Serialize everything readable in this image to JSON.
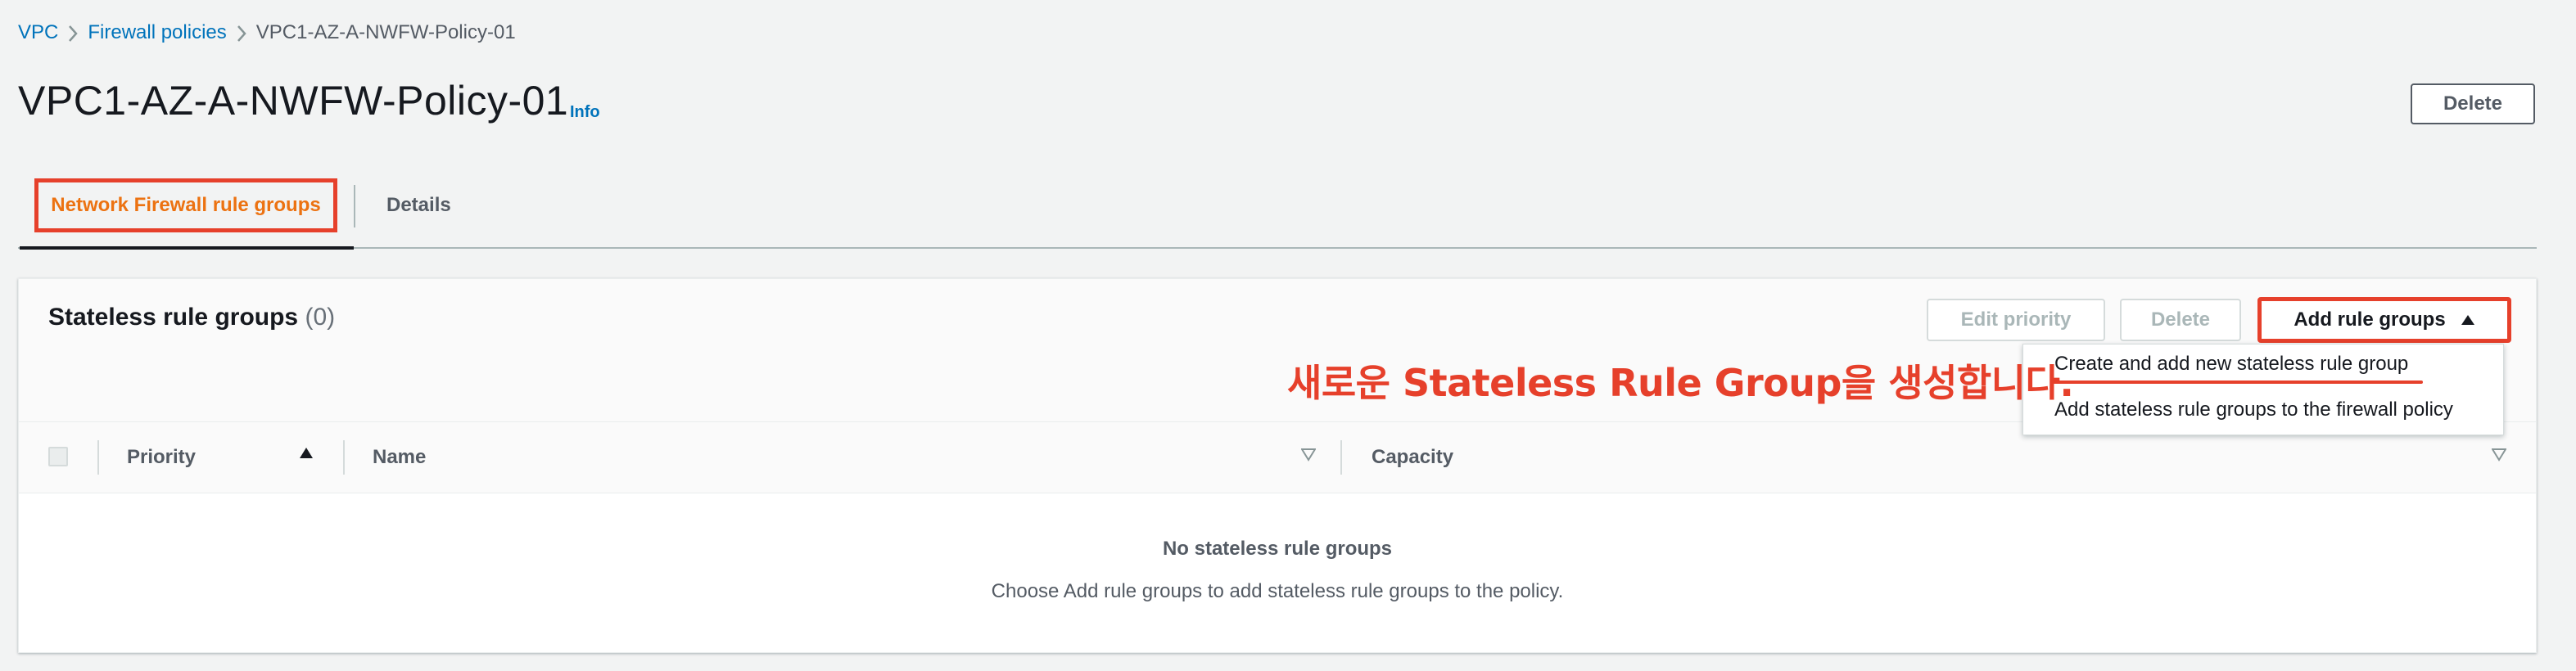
{
  "breadcrumb": {
    "items": [
      "VPC",
      "Firewall policies"
    ],
    "current": "VPC1-AZ-A-NWFW-Policy-01"
  },
  "header": {
    "title": "VPC1-AZ-A-NWFW-Policy-01",
    "info_label": "Info",
    "delete_label": "Delete"
  },
  "tabs": [
    {
      "label": "Network Firewall rule groups",
      "active": true
    },
    {
      "label": "Details",
      "active": false
    }
  ],
  "panel": {
    "title": "Stateless rule groups",
    "count": "(0)",
    "buttons": {
      "edit_priority": "Edit priority",
      "delete": "Delete",
      "add_rule_groups": "Add rule groups"
    },
    "columns": [
      "Priority",
      "Name",
      "Capacity"
    ],
    "empty_title": "No stateless rule groups",
    "empty_description": "Choose Add rule groups to add stateless rule groups to the policy."
  },
  "dropdown": {
    "items": [
      "Create and add new stateless rule group",
      "Add stateless rule groups to the firewall policy"
    ]
  },
  "annotation": "새로운 Stateless Rule Group을 생성합니다.",
  "colors": {
    "link": "#0073bb",
    "accent_orange": "#ec7211",
    "highlight_red": "#e6402b",
    "text": "#16191f",
    "background": "#f2f3f3"
  }
}
